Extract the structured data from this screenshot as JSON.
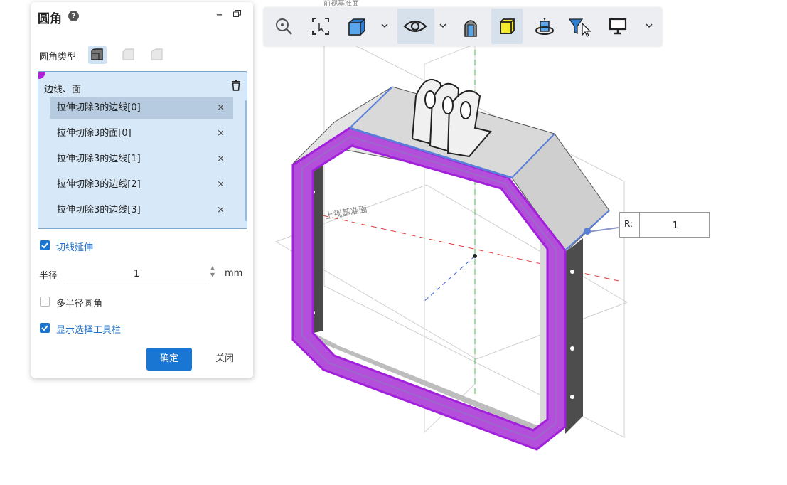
{
  "panel": {
    "title": "圆角",
    "help_icon": "help-icon",
    "fillet_type_label": "圆角类型",
    "selection_header": "边线、面",
    "selection_items": [
      {
        "label": "拉伸切除3的边线[0]",
        "remove": "×"
      },
      {
        "label": "拉伸切除3的面[0]",
        "remove": "×"
      },
      {
        "label": "拉伸切除3的边线[1]",
        "remove": "×"
      },
      {
        "label": "拉伸切除3的边线[2]",
        "remove": "×"
      },
      {
        "label": "拉伸切除3的边线[3]",
        "remove": "×"
      }
    ],
    "tangent_extend_label": "切线延伸",
    "radius_label": "半径",
    "radius_value": "1",
    "radius_unit": "mm",
    "multi_radius_label": "多半径圆角",
    "show_toolbar_label": "显示选择工具栏",
    "ok_label": "确定",
    "close_label": "关闭"
  },
  "toolbar": {
    "icons": [
      "zoom-fit-icon",
      "zoom-box-icon",
      "view-cube-icon",
      "eye-icon",
      "section-icon",
      "shaded-box-icon",
      "rotate-part-icon",
      "selection-filter-icon",
      "display-icon"
    ]
  },
  "viewport": {
    "plane_label": "上视基准面",
    "top_plane_label": "前视基准面",
    "radius_callout_label": "R:",
    "radius_callout_value": "1"
  },
  "colors": {
    "accent": "#1976d2",
    "selection_purple": "#b020d8",
    "selection_bg": "#d7e8f8"
  }
}
